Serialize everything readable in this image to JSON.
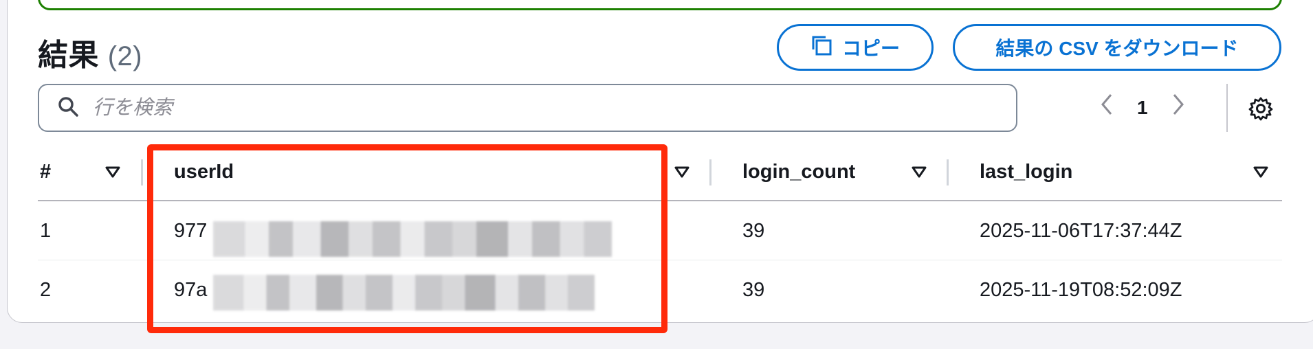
{
  "header": {
    "title": "結果",
    "count": "(2)"
  },
  "actions": {
    "copy_label": "コピー",
    "csv_label": "結果の CSV をダウンロード"
  },
  "search": {
    "placeholder": "行を検索"
  },
  "pagination": {
    "current_page": "1"
  },
  "table": {
    "columns": [
      "#",
      "userId",
      "login_count",
      "last_login"
    ],
    "rows": [
      {
        "index": "1",
        "userId_visible": "977",
        "login_count": "39",
        "last_login": "2025-11-06T17:37:44Z"
      },
      {
        "index": "2",
        "userId_visible": "97a",
        "login_count": "39",
        "last_login": "2025-11-19T08:52:09Z"
      }
    ]
  },
  "colors": {
    "accent": "#0972d3",
    "success_border": "#1d8102",
    "highlight": "#ff2a0a"
  },
  "icons": [
    "copy-icon",
    "search-icon",
    "chevron-left-icon",
    "chevron-right-icon",
    "gear-icon",
    "sort-caret-icon"
  ]
}
